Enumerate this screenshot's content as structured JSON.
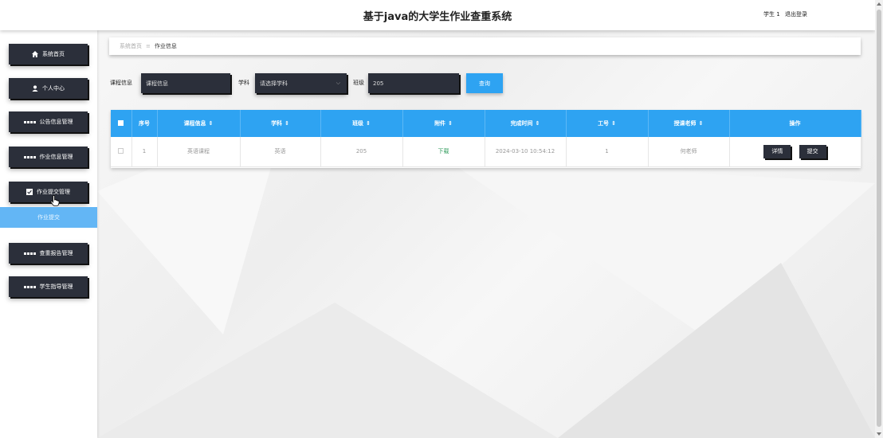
{
  "header": {
    "title": "基于java的大学生作业查重系统",
    "user": "学生 1",
    "logout": "退出登录"
  },
  "sidebar": {
    "items": [
      {
        "label": "系统首页",
        "icon": "home-icon"
      },
      {
        "label": "个人中心",
        "icon": "user-icon"
      },
      {
        "label": "公告信息管理",
        "icon": "grid-icon"
      },
      {
        "label": "作业信息管理",
        "icon": "grid-icon"
      },
      {
        "label": "作业提交管理",
        "icon": "check-square-icon"
      },
      {
        "label": "查重报告管理",
        "icon": "grid-icon"
      },
      {
        "label": "学生指导管理",
        "icon": "grid-icon"
      }
    ],
    "sub_item": {
      "label": "作业提交"
    }
  },
  "breadcrumb": {
    "home": "系统首页",
    "separator": "≡",
    "current": "作业信息"
  },
  "search": {
    "course_label": "课程信息",
    "course_placeholder": "课程信息",
    "subject_label": "学科",
    "subject_placeholder": "请选择学科",
    "class_label": "班级",
    "class_value": "205",
    "query_button": "查询"
  },
  "table": {
    "headers": [
      "序号",
      "课程信息",
      "学科",
      "班级",
      "附件",
      "完成时间",
      "工号",
      "授课老师",
      "操作"
    ],
    "sort_icon": "⇕",
    "rows": [
      {
        "index": "1",
        "course": "英语课程",
        "subject": "英语",
        "class": "205",
        "attachment": "下载",
        "finish_time": "2024-03-10 10:54:12",
        "employee_no": "1",
        "teacher": "何老师",
        "actions": [
          "详情",
          "提交"
        ]
      }
    ]
  },
  "colors": {
    "accent": "#2ea3f2",
    "dark_button": "#2b2f3a",
    "submenu_highlight": "#63b6f5",
    "download_link": "#2e9a5a"
  }
}
